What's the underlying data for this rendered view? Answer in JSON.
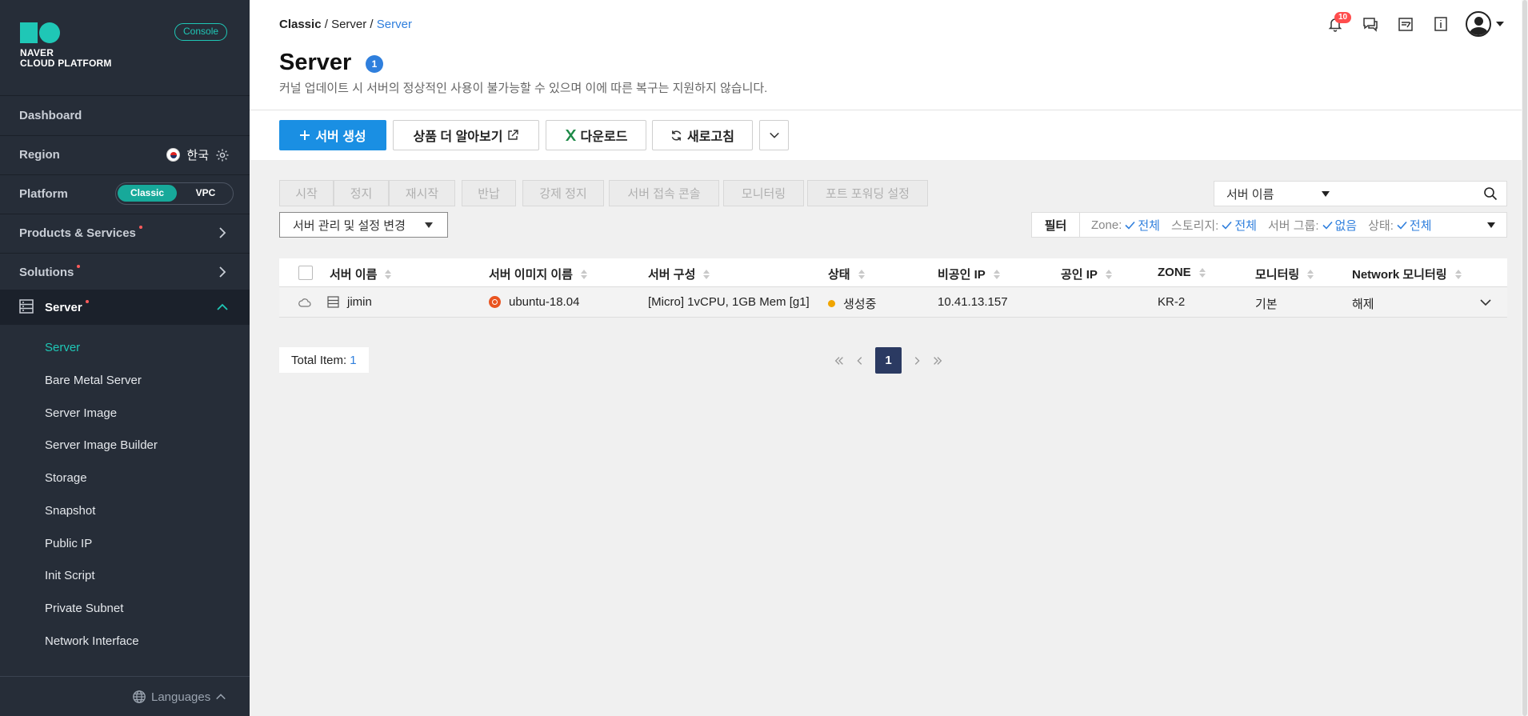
{
  "sidebar": {
    "brand_line1": "NAVER",
    "brand_line2": "CLOUD PLATFORM",
    "console_label": "Console",
    "dashboard": "Dashboard",
    "region_label": "Region",
    "region_value": "한국",
    "platform_label": "Platform",
    "platform_on": "Classic",
    "platform_off": "VPC",
    "products": "Products & Services",
    "solutions": "Solutions",
    "server": "Server",
    "sub_items": [
      "Server",
      "Bare Metal Server",
      "Server Image",
      "Server Image Builder",
      "Storage",
      "Snapshot",
      "Public IP",
      "Init Script",
      "Private Subnet",
      "Network Interface"
    ],
    "languages": "Languages"
  },
  "header": {
    "crumb1": "Classic",
    "crumb2": "Server",
    "crumb3": "Server",
    "title": "Server",
    "title_badge": "1",
    "description": "커널 업데이트 시 서버의 정상적인 사용이 불가능할 수 있으며 이에 따른 복구는 지원하지 않습니다.",
    "notif_count": "10"
  },
  "buttons": {
    "create": "서버 생성",
    "learn_more": "상품 더 알아보기",
    "download": "다운로드",
    "refresh": "새로고침"
  },
  "actions": [
    "시작",
    "정지",
    "재시작",
    "반납",
    "강제 정지",
    "서버 접속 콘솔",
    "모니터링",
    "포트 포워딩 설정"
  ],
  "manage_label": "서버 관리 및 설정 변경",
  "search": {
    "select_value": "서버 이름",
    "placeholder": ""
  },
  "filter": {
    "label": "필터",
    "zone_label": "Zone:",
    "zone_value": "전체",
    "storage_label": "스토리지:",
    "storage_value": "전체",
    "group_label": "서버 그룹:",
    "group_value": "없음",
    "state_label": "상태:",
    "state_value": "전체"
  },
  "table": {
    "headers": [
      "서버 이름",
      "서버 이미지 이름",
      "서버 구성",
      "상태",
      "비공인 IP",
      "공인 IP",
      "ZONE",
      "모니터링",
      "Network 모니터링"
    ],
    "row": {
      "name": "jimin",
      "image": "ubuntu-18.04",
      "spec": "[Micro] 1vCPU, 1GB Mem [g1]",
      "status": "생성중",
      "private_ip": "10.41.13.157",
      "public_ip": "",
      "zone": "KR-2",
      "monitoring": "기본",
      "net_monitoring": "해제"
    }
  },
  "footer": {
    "total_label": "Total Item:",
    "total_value": "1",
    "current_page": "1"
  },
  "colors": {
    "accent": "#1fc7b6",
    "primary": "#1a8fe3",
    "link": "#2f7fdd",
    "sidebar_bg": "#262d38"
  }
}
